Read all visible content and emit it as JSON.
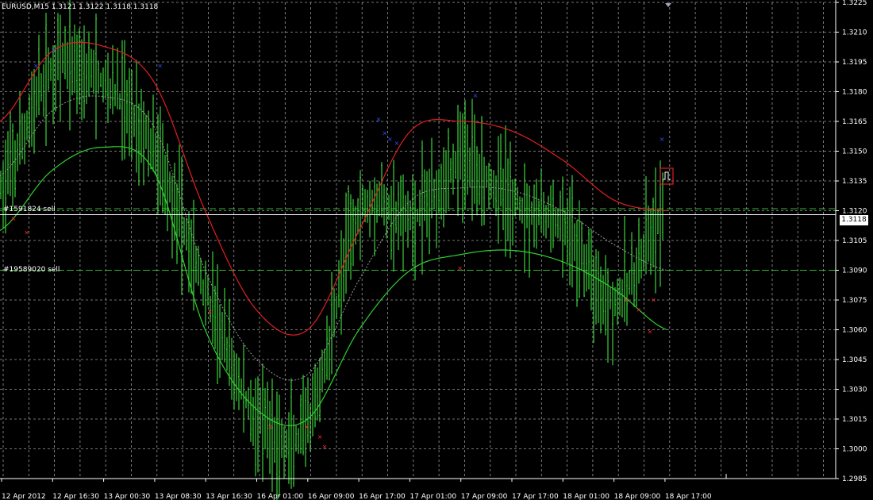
{
  "window": {
    "symbol_label": "EURUSD,M15",
    "ohlc_label": "1.3121 1.3122 1.3118 1.3118"
  },
  "colors": {
    "background": "#000000",
    "grid": "#9a9a9a",
    "bars": "#3bd13b",
    "upper_band": "#e02020",
    "lower_band": "#30d030",
    "middle_line": "#9a9a9a",
    "buy_marker": "#3050ff",
    "sell_marker": "#ff2a2a",
    "order_line": "#2fb82f",
    "price_line": "#ffffff"
  },
  "price_axis": {
    "ticks": [
      "1.3225",
      "1.3210",
      "1.3195",
      "1.3180",
      "1.3165",
      "1.3150",
      "1.3135",
      "1.3120",
      "1.3105",
      "1.3090",
      "1.3075",
      "1.3060",
      "1.3045",
      "1.3030",
      "1.3015",
      "1.3000",
      "1.2985"
    ],
    "min": 1.2985,
    "max": 1.3225,
    "current_price": "1.3118"
  },
  "time_axis": {
    "labels": [
      "12 Apr 2012",
      "12 Apr 16:30",
      "13 Apr 00:30",
      "13 Apr 08:30",
      "13 Apr 16:30",
      "16 Apr 01:00",
      "16 Apr 09:00",
      "16 Apr 17:00",
      "17 Apr 01:00",
      "17 Apr 09:00",
      "17 Apr 17:00",
      "18 Apr 01:00",
      "18 Apr 09:00",
      "18 Apr 17:00"
    ]
  },
  "orders": [
    {
      "label": "#1591824 sell",
      "price": 1.3121
    },
    {
      "label": "#19589020 sell",
      "price": 1.309
    }
  ],
  "icons": {
    "alert_box": "square-wave-icon",
    "shift_marker": "triangle-down-icon"
  },
  "chart_data": {
    "type": "line",
    "symbol": "EURUSD",
    "timeframe": "M15",
    "x": [
      "12 Apr 2012",
      "12 Apr 16:30",
      "13 Apr 00:30",
      "13 Apr 08:30",
      "13 Apr 16:30",
      "16 Apr 01:00",
      "16 Apr 09:00",
      "16 Apr 17:00",
      "17 Apr 01:00",
      "17 Apr 09:00",
      "17 Apr 17:00",
      "18 Apr 01:00",
      "18 Apr 09:00",
      "18 Apr 17:00"
    ],
    "series": [
      {
        "values": [
          1.313,
          1.319,
          1.3185,
          1.315,
          1.308,
          1.3015,
          1.301,
          1.312,
          1.3115,
          1.3145,
          1.3125,
          1.311,
          1.3075,
          1.3118
        ]
      },
      {
        "values": [
          1.3165,
          1.32,
          1.3203,
          1.3185,
          1.312,
          1.307,
          1.306,
          1.311,
          1.316,
          1.3165,
          1.316,
          1.3145,
          1.3125,
          1.312
        ]
      },
      {
        "values": [
          1.311,
          1.314,
          1.3152,
          1.314,
          1.306,
          1.302,
          1.3015,
          1.306,
          1.309,
          1.3098,
          1.31,
          1.3094,
          1.308,
          1.306
        ]
      }
    ],
    "ylim": [
      1.2985,
      1.3225
    ],
    "grid": true
  }
}
